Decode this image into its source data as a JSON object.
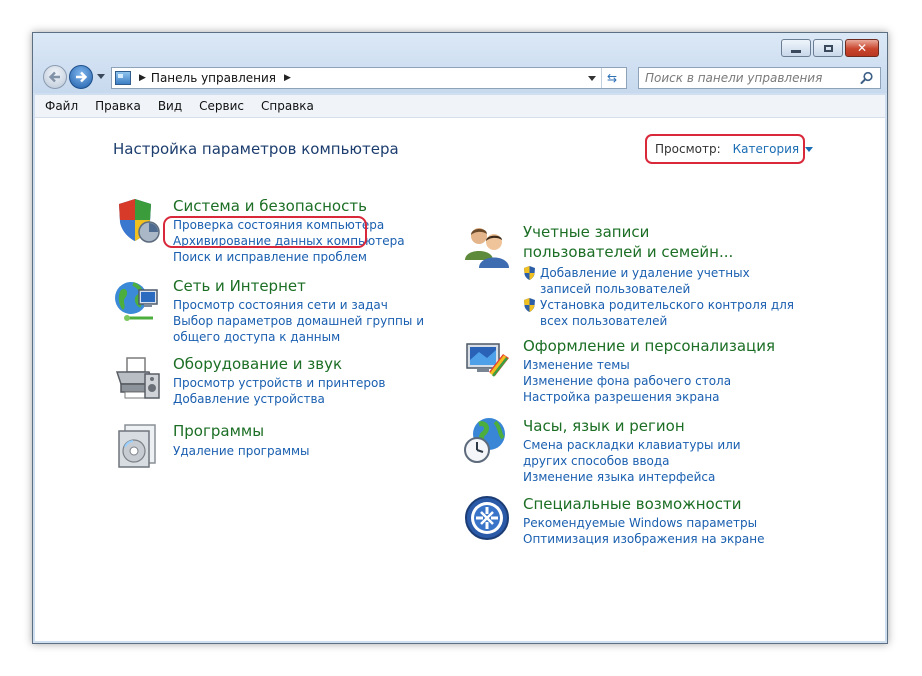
{
  "window": {
    "caption_buttons": {
      "minimize": "minimize-icon",
      "maximize": "maximize-icon",
      "close": "close-icon"
    }
  },
  "address_bar": {
    "path": "Панель управления"
  },
  "search": {
    "placeholder": "Поиск в панели управления"
  },
  "menu": [
    "Файл",
    "Правка",
    "Вид",
    "Сервис",
    "Справка"
  ],
  "main": {
    "title": "Настройка параметров компьютера",
    "view": {
      "label": "Просмотр:",
      "value": "Категория"
    }
  },
  "categories": [
    {
      "title": "Система и безопасность",
      "icon": "shield-icon",
      "links": [
        "Проверка состояния компьютера",
        "Архивирование данных компьютера",
        "Поиск и исправление проблем"
      ]
    },
    {
      "title": "Сеть и Интернет",
      "icon": "network-globe-icon",
      "links": [
        "Просмотр состояния сети и задач",
        "Выбор параметров домашней группы и общего доступа к данным"
      ]
    },
    {
      "title": "Оборудование и звук",
      "icon": "printer-icon",
      "links": [
        "Просмотр устройств и принтеров",
        "Добавление устройства"
      ]
    },
    {
      "title": "Программы",
      "icon": "programs-icon",
      "links": [
        "Удаление программы"
      ]
    },
    {
      "title": "Учетные записи пользователей и семейн...",
      "icon": "users-icon",
      "links": [
        "Добавление и удаление учетных записей пользователей",
        "Установка родительского контроля для всех пользователей"
      ]
    },
    {
      "title": "Оформление и персонализация",
      "icon": "personalization-icon",
      "links": [
        "Изменение темы",
        "Изменение фона рабочего стола",
        "Настройка разрешения экрана"
      ]
    },
    {
      "title": "Часы, язык и регион",
      "icon": "clock-globe-icon",
      "links": [
        "Смена раскладки клавиатуры или других способов ввода",
        "Изменение языка интерфейса"
      ]
    },
    {
      "title": "Специальные возможности",
      "icon": "accessibility-icon",
      "links": [
        "Рекомендуемые Windows параметры",
        "Оптимизация изображения на экране"
      ]
    }
  ],
  "colors": {
    "category_title": "#1b6e24",
    "link": "#1a5fb0",
    "highlight": "#d9283a",
    "page_title": "#1c3d6e"
  }
}
